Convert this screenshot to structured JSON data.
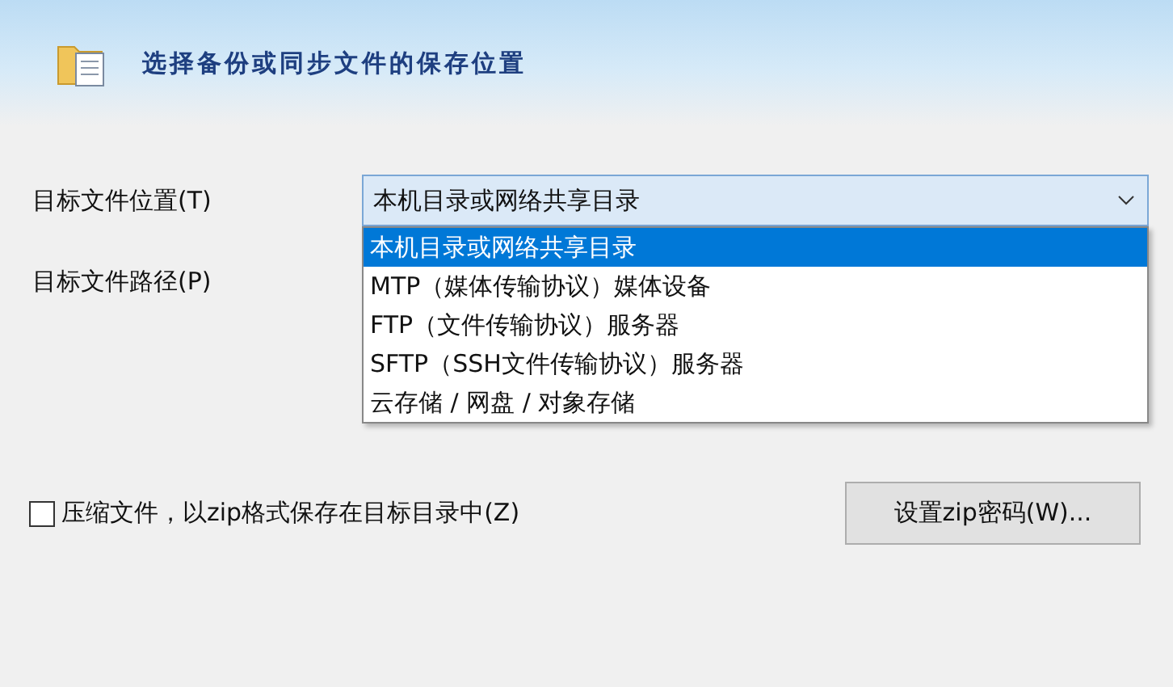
{
  "header": {
    "title": "选择备份或同步文件的保存位置"
  },
  "location": {
    "label": "目标文件位置(T)",
    "value": "本机目录或网络共享目录",
    "expanded": true,
    "options": [
      {
        "label": "本机目录或网络共享目录",
        "selected": true
      },
      {
        "label": "MTP（媒体传输协议）媒体设备",
        "selected": false
      },
      {
        "label": "FTP（文件传输协议）服务器",
        "selected": false
      },
      {
        "label": "SFTP（SSH文件传输协议）服务器",
        "selected": false
      },
      {
        "label": "云存储 / 网盘 / 对象存储",
        "selected": false
      }
    ]
  },
  "path": {
    "label": "目标文件路径(P)"
  },
  "compress": {
    "label": "压缩文件，以zip格式保存在目标目录中(Z)",
    "checked": false
  },
  "zip_button": {
    "label": "设置zip密码(W)..."
  }
}
